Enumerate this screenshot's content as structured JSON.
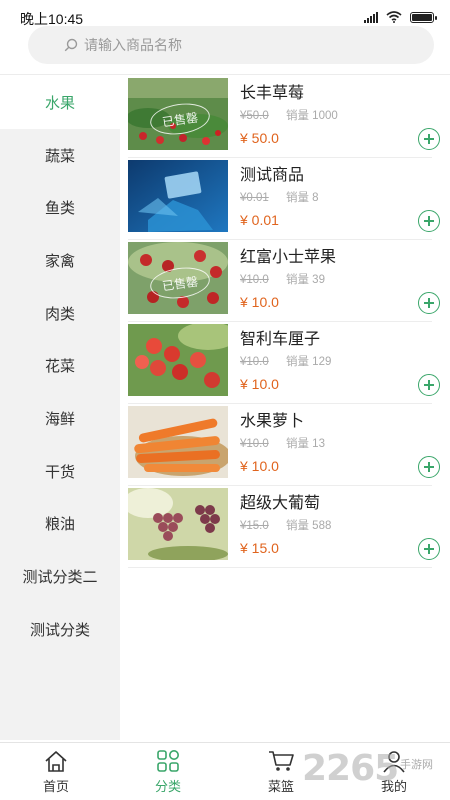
{
  "status_bar": {
    "time": "晚上10:45"
  },
  "search": {
    "placeholder": "请输入商品名称"
  },
  "categories": [
    {
      "label": "水果",
      "active": true
    },
    {
      "label": "蔬菜"
    },
    {
      "label": "鱼类"
    },
    {
      "label": "家禽"
    },
    {
      "label": "肉类"
    },
    {
      "label": "花菜"
    },
    {
      "label": "海鲜"
    },
    {
      "label": "干货"
    },
    {
      "label": "粮油"
    },
    {
      "label": "测试分类二"
    },
    {
      "label": "测试分类"
    }
  ],
  "products": [
    {
      "name": "长丰草莓",
      "original_price": "¥50.0",
      "sales_label": "销量 1000",
      "price": "¥ 50.0",
      "sold_out_stamp": "已售罄",
      "image": "strawberry-field-photo"
    },
    {
      "name": "测试商品",
      "original_price": "¥0.01",
      "sales_label": "销量 8",
      "price": "¥ 0.01",
      "image": "card-in-hand-photo"
    },
    {
      "name": "红富小士苹果",
      "original_price": "¥10.0",
      "sales_label": "销量 39",
      "price": "¥ 10.0",
      "sold_out_stamp": "已售罄",
      "image": "apple-tree-photo"
    },
    {
      "name": "智利车厘子",
      "original_price": "¥10.0",
      "sales_label": "销量 129",
      "price": "¥ 10.0",
      "image": "cherries-photo"
    },
    {
      "name": "水果萝卜",
      "original_price": "¥10.0",
      "sales_label": "销量 13",
      "price": "¥ 10.0",
      "image": "carrots-photo"
    },
    {
      "name": "超级大葡萄",
      "original_price": "¥15.0",
      "sales_label": "销量 588",
      "price": "¥ 15.0",
      "image": "grapes-photo"
    }
  ],
  "tabs": [
    {
      "label": "首页",
      "icon": "home-icon"
    },
    {
      "label": "分类",
      "icon": "category-icon",
      "active": true
    },
    {
      "label": "菜篮",
      "icon": "cart-icon"
    },
    {
      "label": "我的",
      "icon": "user-icon"
    }
  ],
  "watermark": {
    "number": "2265",
    "text": "手游网"
  },
  "colors": {
    "accent": "#3aa66a",
    "price": "#e0641e",
    "sidebar_bg": "#f2f2f2"
  }
}
